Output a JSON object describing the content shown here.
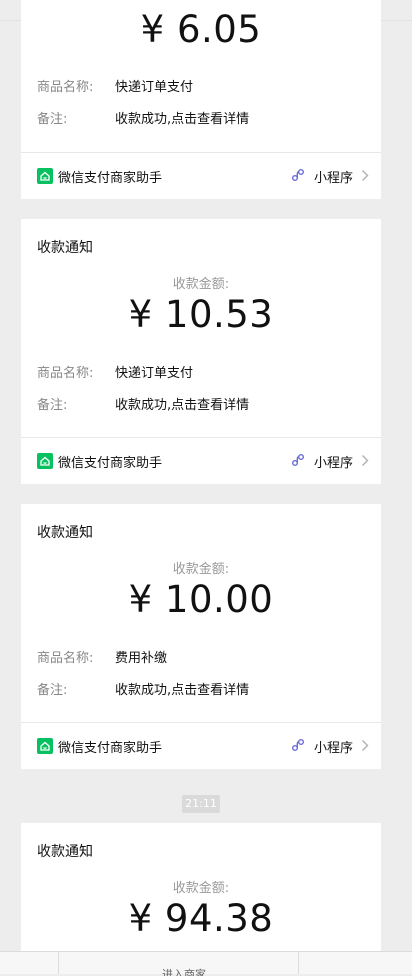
{
  "cards": [
    {
      "title": "",
      "amount_label": "",
      "amount": "¥ 6.05",
      "rows": [
        {
          "key": "商品名称:",
          "value": "快递订单支付"
        },
        {
          "key": "备注:",
          "value": "收款成功,点击查看详情"
        }
      ],
      "footer": {
        "source": "微信支付商家助手",
        "mini_program": "小程序"
      }
    },
    {
      "title": "收款通知",
      "amount_label": "收款金额:",
      "amount": "¥ 10.53",
      "rows": [
        {
          "key": "商品名称:",
          "value": "快递订单支付"
        },
        {
          "key": "备注:",
          "value": "收款成功,点击查看详情"
        }
      ],
      "footer": {
        "source": "微信支付商家助手",
        "mini_program": "小程序"
      }
    },
    {
      "title": "收款通知",
      "amount_label": "收款金额:",
      "amount": "¥ 10.00",
      "rows": [
        {
          "key": "商品名称:",
          "value": "费用补缴"
        },
        {
          "key": "备注:",
          "value": "收款成功,点击查看详情"
        }
      ],
      "footer": {
        "source": "微信支付商家助手",
        "mini_program": "小程序"
      }
    },
    {
      "title": "收款通知",
      "amount_label": "收款金额:",
      "amount": "¥ 94.38"
    }
  ],
  "timestamp": "21:11",
  "bottom_tab": "进入商家",
  "colors": {
    "background": "#ededed",
    "wechat_green": "#07c160",
    "link_purple": "#6b6bd6"
  },
  "icons": [
    "wechat-pay-icon",
    "mini-program-link-icon",
    "chevron-right-icon"
  ]
}
